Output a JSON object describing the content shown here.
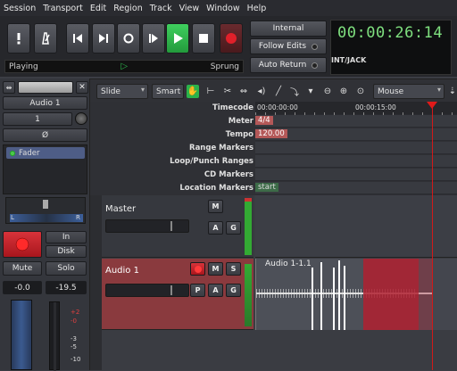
{
  "menu": [
    "Session",
    "Transport",
    "Edit",
    "Region",
    "Track",
    "View",
    "Window",
    "Help"
  ],
  "transport": {
    "status_left": "Playing",
    "status_right": "Sprung",
    "sync_internal": "Internal",
    "follow_edits": "Follow Edits",
    "auto_return": "Auto Return",
    "clock": "00:00:26:14",
    "clock_source": "INT/JACK"
  },
  "edit_toolbar": {
    "edit_mode": "Slide",
    "grid_mode": "Smart",
    "zoom_focus": "Mouse"
  },
  "mixer_strip": {
    "name": "Audio 1",
    "input_channel": "1",
    "phase": "Ø",
    "plugin": "Fader",
    "pan_left": "L",
    "pan_right": "R",
    "in_label": "In",
    "disk_label": "Disk",
    "mute_label": "Mute",
    "solo_label": "Solo",
    "gain_value": "-0.0",
    "peak_value": "-19.5",
    "meter_ticks": [
      "+2",
      "-0",
      "-3",
      "-5",
      "-10"
    ]
  },
  "rulers": {
    "labels": [
      "Timecode",
      "Meter",
      "Tempo",
      "Range Markers",
      "Loop/Punch Ranges",
      "CD Markers",
      "Location Markers"
    ],
    "timecode_ticks": [
      "00:00:00:00",
      "00:00:15:00"
    ],
    "meter": "4/4",
    "tempo": "120.00",
    "location_marker": "start"
  },
  "tracks": [
    {
      "name": "Master",
      "buttons": [
        "M",
        "A",
        "G"
      ]
    },
    {
      "name": "Audio 1",
      "buttons": [
        "M",
        "S",
        "P",
        "A",
        "G"
      ],
      "region": "Audio 1-1.1"
    }
  ],
  "colors": {
    "play_green": "#2bb34a",
    "record_red": "#e0202a",
    "clock_green": "#7fe07f",
    "track_selected": "#8a3a3e",
    "playhead": "#d01a1a",
    "region_red": "#b02030"
  }
}
